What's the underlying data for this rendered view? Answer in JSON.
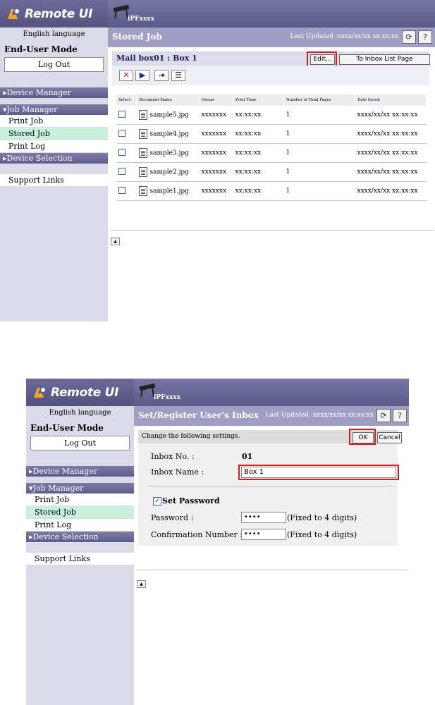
{
  "common": {
    "app_logo": "Remote UI",
    "model": "iPFxxxx",
    "language": "English language",
    "mode": "End-User Mode",
    "logout": "Log Out",
    "nav": {
      "device_manager": "Device Manager",
      "job_manager": "Job Manager",
      "print_job": "Print Job",
      "stored_job": "Stored Job",
      "print_log": "Print Log",
      "device_selection": "Device Selection",
      "support_links": "Support Links"
    },
    "refresh_glyph": "⟳",
    "help_label": "?",
    "top_glyph": "▲"
  },
  "screen1": {
    "page_title": "Stored Job",
    "last_updated": "Last Updated :xxxx/xx/xx xx:xx:xx",
    "mailbox_title": "Mail box01 : Box 1",
    "edit_button": "Edit...",
    "inbox_list_button": "To Inbox List Page",
    "toolbar_icons": [
      "delete-icon",
      "print-icon",
      "move-icon",
      "details-icon"
    ],
    "table": {
      "headers": [
        "Select",
        "Document Name",
        "Owner",
        "Print Time",
        "Number of Total Pages",
        "Date Saved"
      ],
      "rows": [
        {
          "name": "sample5.jpg",
          "owner": "xxxxxxx",
          "time": "xx:xx:xx",
          "pages": "1",
          "date": "xxxx/xx/xx xx:xx:xx"
        },
        {
          "name": "sample4.jpg",
          "owner": "xxxxxxx",
          "time": "xx:xx:xx",
          "pages": "1",
          "date": "xxxx/xx/xx xx:xx:xx"
        },
        {
          "name": "sample3.jpg",
          "owner": "xxxxxxx",
          "time": "xx:xx:xx",
          "pages": "1",
          "date": "xxxx/xx/xx xx:xx:xx"
        },
        {
          "name": "sample2.jpg",
          "owner": "xxxxxxx",
          "time": "xx:xx:xx",
          "pages": "1",
          "date": "xxxx/xx/xx xx:xx:xx"
        },
        {
          "name": "sample1.jpg",
          "owner": "xxxxxxx",
          "time": "xx:xx:xx",
          "pages": "1",
          "date": "xxxx/xx/xx xx:xx:xx"
        }
      ]
    }
  },
  "screen2": {
    "page_title": "Set/Register User's Inbox",
    "last_updated": "Last Updated :xxxx/xx/xx xx:xx:xx",
    "instruction": "Change the following settings.",
    "ok_button": "OK",
    "cancel_button": "Cancel",
    "inbox_no_label": "Inbox No. :",
    "inbox_no_value": "01",
    "inbox_name_label": "Inbox Name :",
    "inbox_name_value": "Box 1",
    "set_password_label": "Set Password",
    "set_password_checked": true,
    "password_label": "Password :",
    "password_value": "••••",
    "password_note": "(Fixed to 4 digits)",
    "confirm_label": "Confirmation Number :",
    "confirm_value": "••••",
    "confirm_note": "(Fixed to 4 digits)"
  },
  "colors": {
    "header": "#5b5987",
    "sidebar": "#dadae8",
    "active_item": "#c8f0dc",
    "highlight": "#d02020"
  }
}
